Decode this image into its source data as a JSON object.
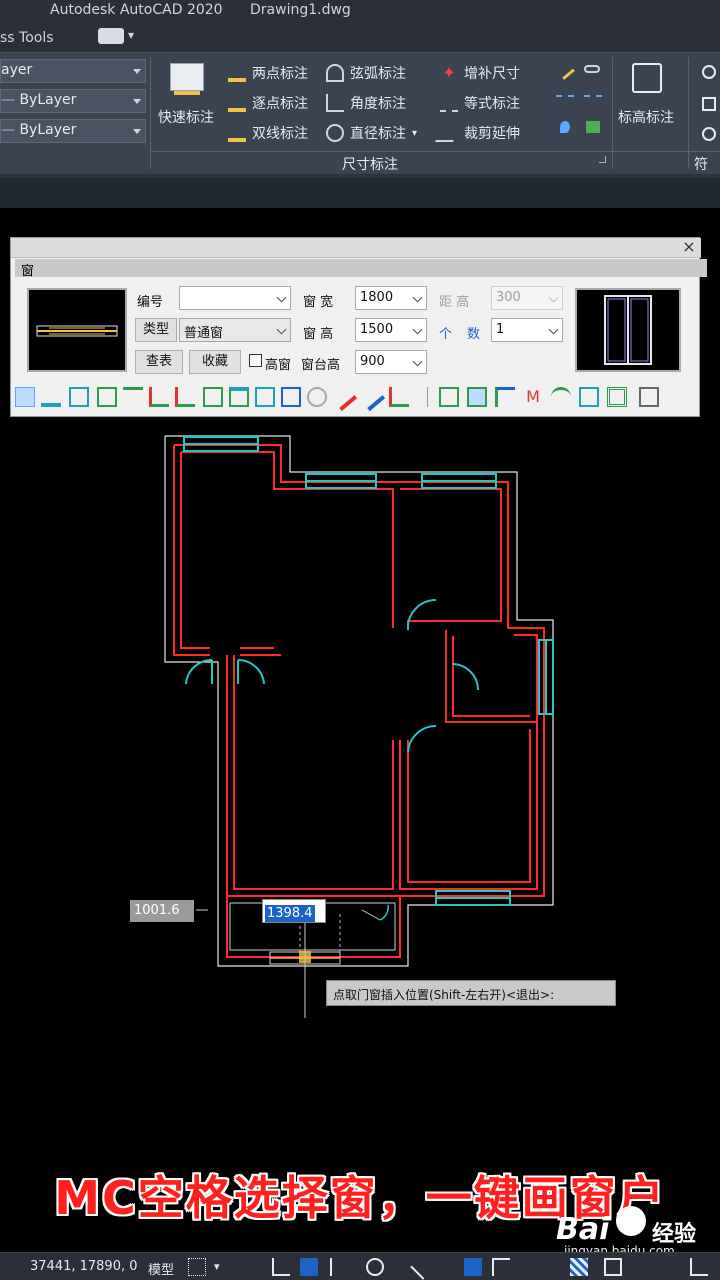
{
  "titlebar": {
    "app": "Autodesk AutoCAD 2020",
    "file": "Drawing1.dwg"
  },
  "tabs": {
    "current": "ss Tools",
    "extra": "▾"
  },
  "ribbon": {
    "layer1": "ayer",
    "layer2": "ByLayer",
    "layer3": "ByLayer",
    "quick_dim": "快速标注",
    "b_twopoint": "两点标注",
    "b_arc": "弦弧标注",
    "b_addsize": "增补尺寸",
    "b_step": "逐点标注",
    "b_angle": "角度标注",
    "b_equal": "等式标注",
    "b_double": "双线标注",
    "b_radius": "直径标注",
    "b_trim": "裁剪延伸",
    "panel_title": "尺寸标注",
    "elev": "标高标注",
    "symbols": "符号"
  },
  "dialog": {
    "tab": "窗",
    "close": "×",
    "lbl_number": "编号",
    "number_value": "",
    "lbl_width": "窗  宽",
    "width_value": "1800",
    "lbl_distance": "距  高",
    "distance_value": "300",
    "btn_type": "类型",
    "type_value": "普通窗",
    "lbl_height": "窗  高",
    "height_value": "1500",
    "count_label1": "个",
    "count_label2": "数",
    "count_value": "1",
    "btn_lookup": "查表",
    "btn_favorite": "收藏",
    "chk_high": "高窗",
    "lbl_sill": "窗台高",
    "sill_value": "900"
  },
  "drawing": {
    "dim_readout": "1001.6",
    "dyn_input": "1398.4",
    "prompt": "点取门窗插入位置(Shift-左右开)<退出>:"
  },
  "caption": "MC空格选择窗，一键画窗户",
  "statusbar": {
    "coords": "37441, 17890, 0",
    "model": "模型"
  },
  "watermark": {
    "brand": "Bai",
    "brand2": "经验",
    "url": "jingyan.baidu.com"
  },
  "colors": {
    "wall": "#ff2a2a",
    "outline": "#e8e8e8",
    "window": "#22c7c7",
    "caption": "#ff1f1f"
  }
}
